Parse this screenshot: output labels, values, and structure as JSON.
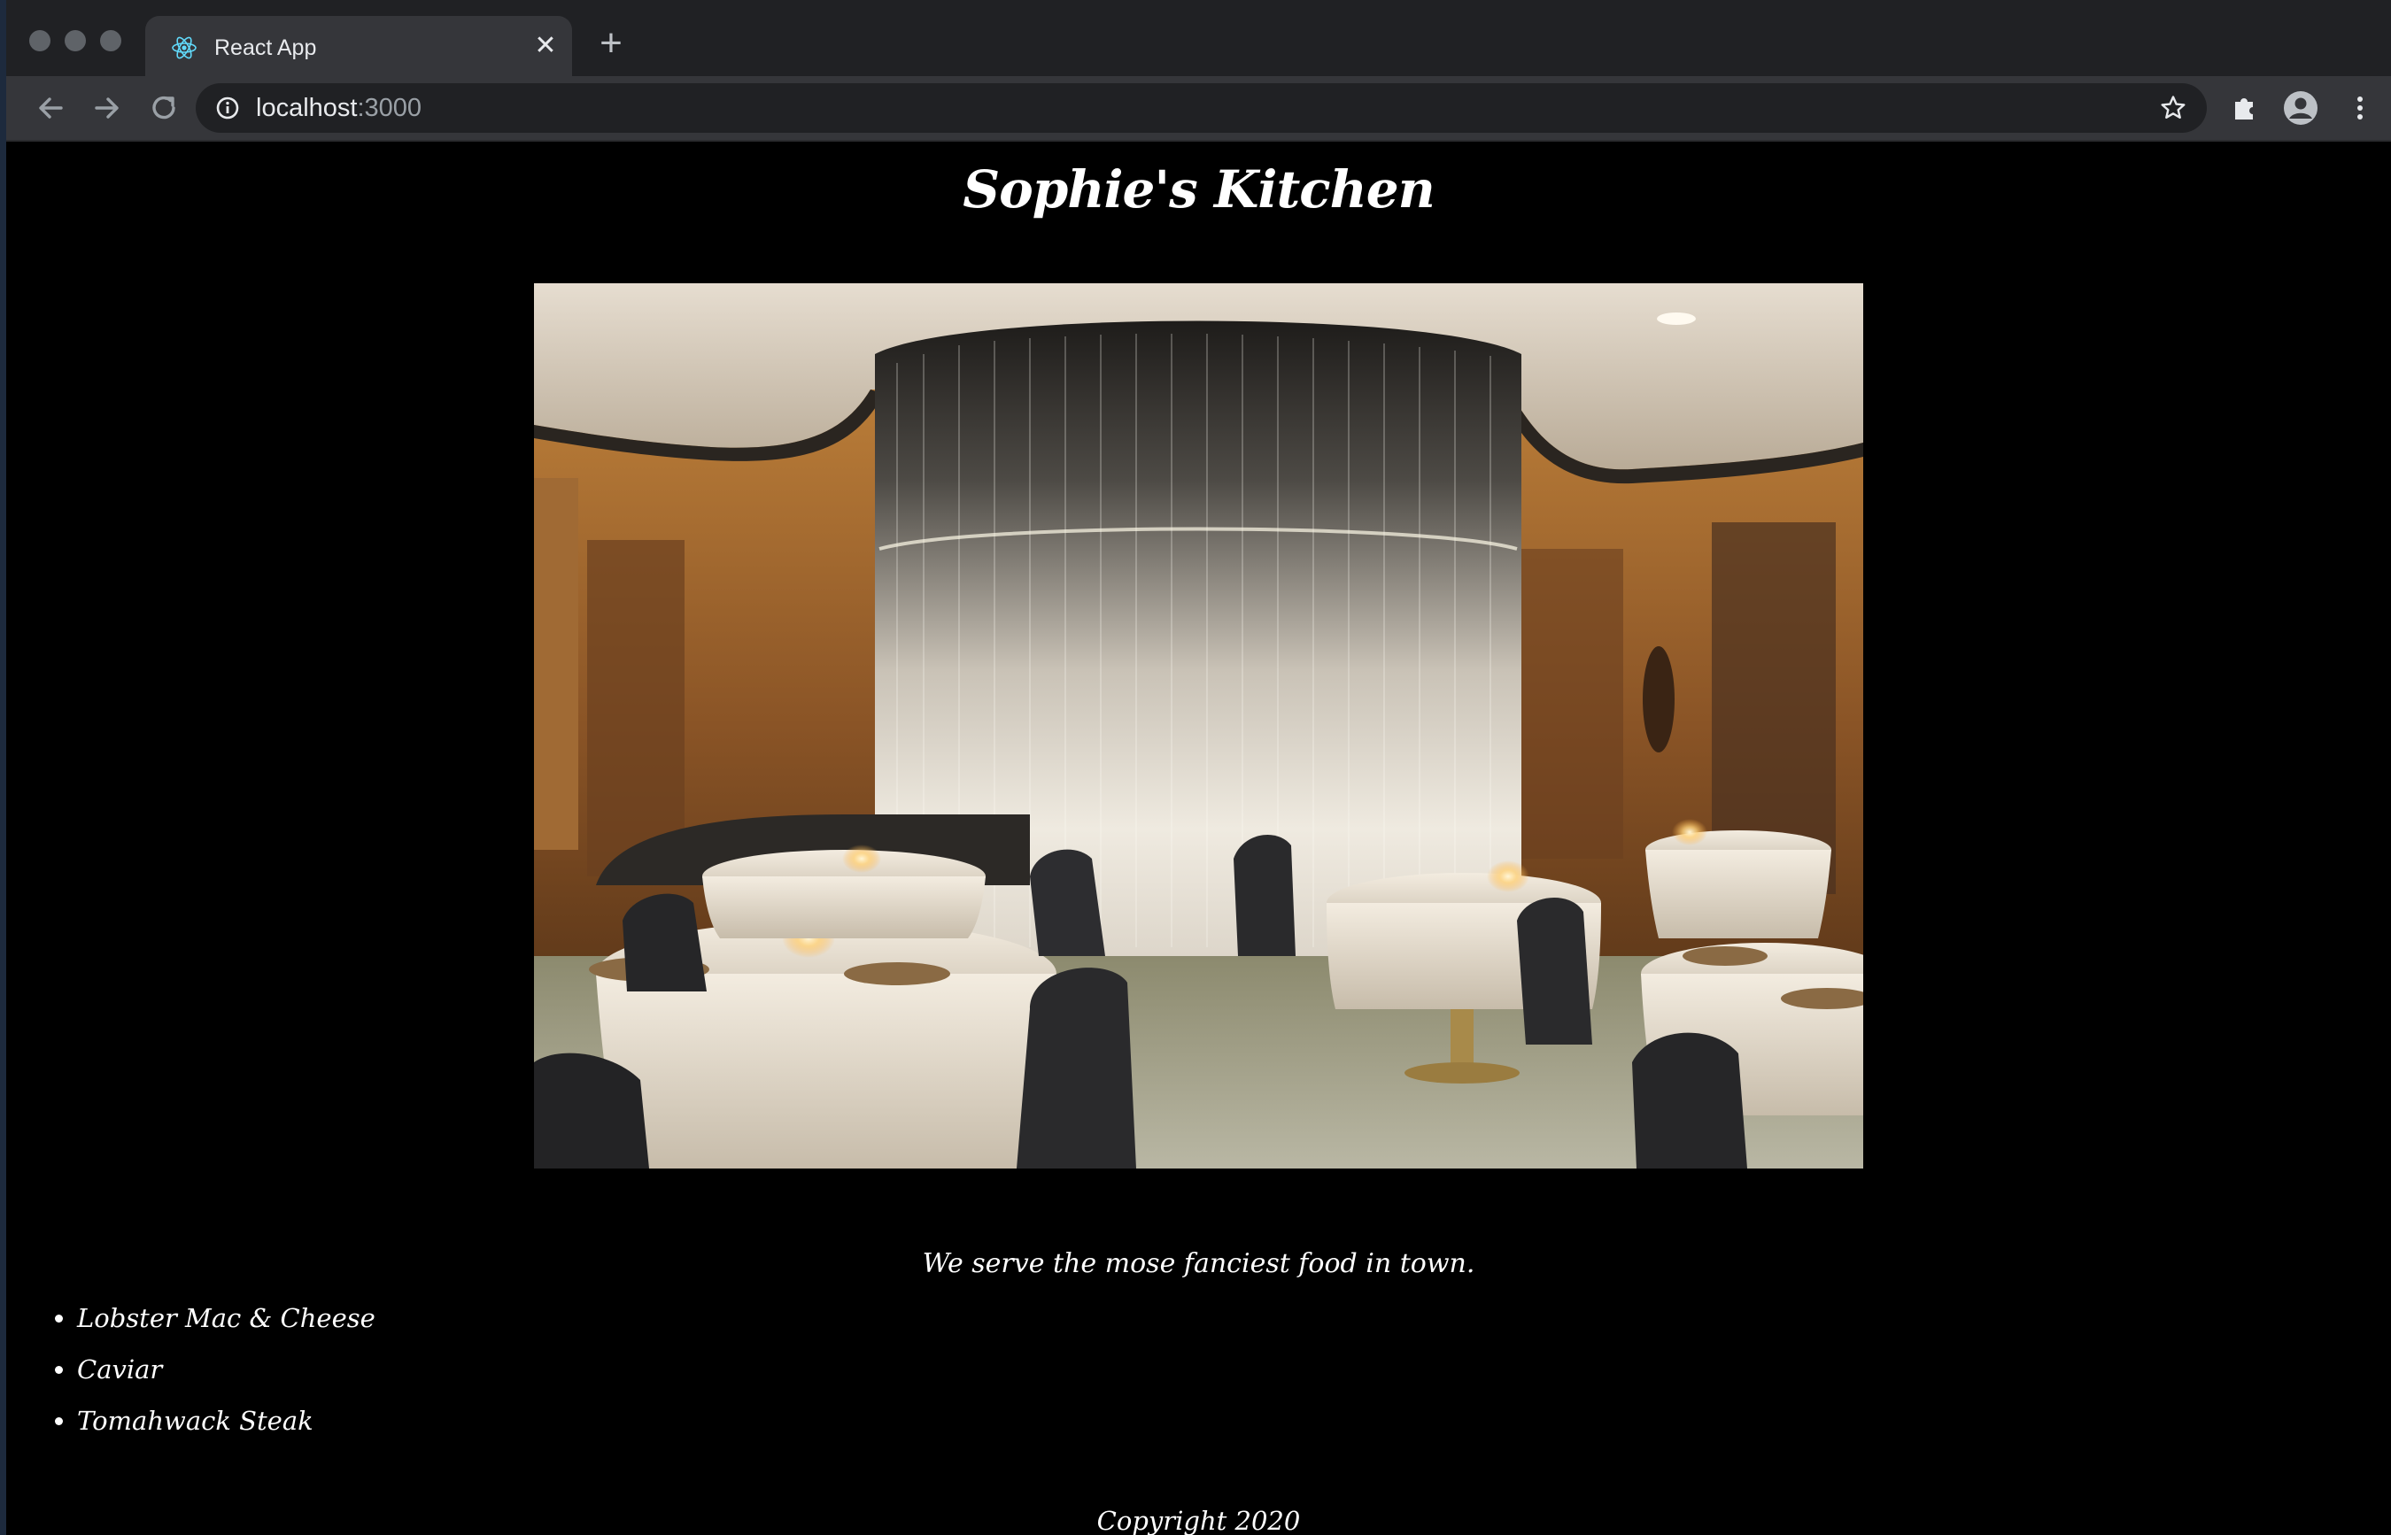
{
  "browser": {
    "tab": {
      "title": "React App",
      "close_icon": "close-icon",
      "favicon": "react-logo-icon"
    },
    "new_tab_icon": "plus-icon",
    "address_bar": {
      "host": "localhost",
      "port": ":3000"
    },
    "icons": [
      "back-arrow-icon",
      "forward-arrow-icon",
      "reload-icon",
      "info-icon",
      "star-icon",
      "extensions-icon",
      "profile-icon",
      "menu-icon"
    ],
    "colors": {
      "frame": "#202124",
      "toolbar": "#35363a",
      "omnibox": "#202124"
    }
  },
  "page": {
    "title": "Sophie's Kitchen",
    "hero_image": "restaurant-dining-room-photo",
    "tagline": "We serve the mose fanciest food in town.",
    "menu_items": [
      "Lobster Mac & Cheese",
      "Caviar",
      "Tomahwack Steak"
    ],
    "copyright": "Copyright 2020",
    "colors": {
      "background": "#000000",
      "text": "#ffffff"
    }
  }
}
